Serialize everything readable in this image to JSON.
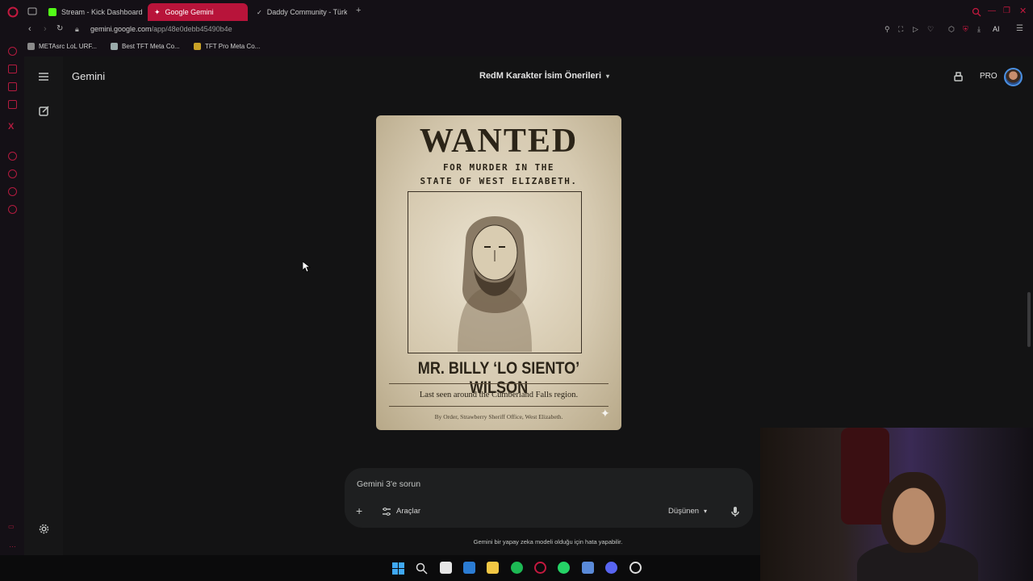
{
  "browser": {
    "tabs": [
      {
        "label": "Stream - Kick Dashboard",
        "active": false,
        "icon": "kick-icon",
        "color": "#53fc18"
      },
      {
        "label": "Google Gemini",
        "active": true,
        "icon": "gemini-icon",
        "color": "#ffffff"
      },
      {
        "label": "Daddy Community - Türk",
        "active": false,
        "icon": "community-icon",
        "color": "#cccccc"
      }
    ],
    "url_host": "gemini.google.com",
    "url_path": "/app/48e0debb45490b4e",
    "bookmarks": [
      {
        "label": "METAsrc LoL URF..."
      },
      {
        "label": "Best TFT Meta Co..."
      },
      {
        "label": "TFT Pro Meta Co..."
      }
    ],
    "toolbar_ai_label": "AI"
  },
  "gemini": {
    "brand": "Gemini",
    "conversation_title": "RedM Karakter İsim Önerileri",
    "pro_label": "PRO"
  },
  "poster": {
    "headline": "WANTED",
    "line1": "FOR MURDER IN THE",
    "line2": "STATE OF WEST ELIZABETH.",
    "name": "MR. BILLY ‘LO SIENTO’ WILSON",
    "last_seen": "Last seen around the Cumberland Falls region.",
    "order": "By Order, Strawberry Sheriff Office, West Elizabeth."
  },
  "composer": {
    "placeholder": "Gemini 3'e sorun",
    "tools_label": "Araçlar",
    "mode_label": "Düşünen"
  },
  "disclaimer": "Gemini bir yapay zeka modeli olduğu için hata yapabilir.",
  "colors": {
    "accent": "#b8143a",
    "background": "#131314",
    "composer_bg": "#1e1f20"
  }
}
